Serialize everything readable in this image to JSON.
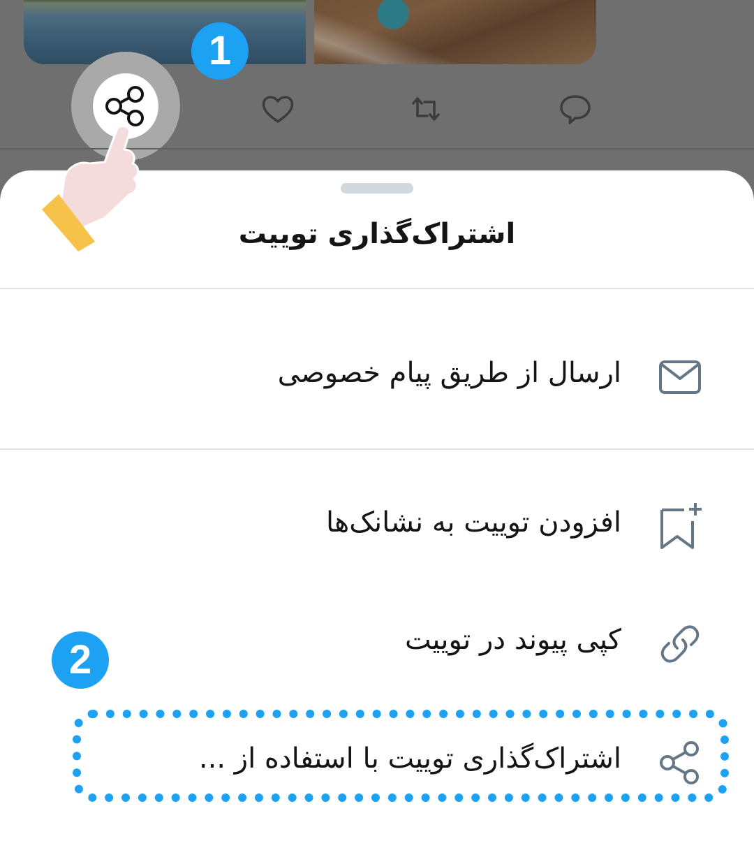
{
  "tweet": {
    "actions": [
      {
        "name": "share-icon"
      },
      {
        "name": "heart-icon"
      },
      {
        "name": "retweet-icon"
      },
      {
        "name": "reply-icon"
      }
    ]
  },
  "steps": {
    "one": "1",
    "two": "2"
  },
  "sheet": {
    "title": "اشتراک‌گذاری توییت",
    "items": [
      {
        "label": "ارسال از طریق پیام خصوصی",
        "icon": "envelope-icon"
      },
      {
        "label": "افزودن توییت به نشانک‌ها",
        "icon": "bookmark-add-icon"
      },
      {
        "label": "کپی پیوند در توییت",
        "icon": "link-icon"
      },
      {
        "label": "اشتراک‌گذاری توییت با استفاده از ...",
        "icon": "share-icon"
      }
    ]
  },
  "colors": {
    "accent": "#1da1f2",
    "overlay": "#6f6f6f",
    "icon_gray": "#657786"
  }
}
